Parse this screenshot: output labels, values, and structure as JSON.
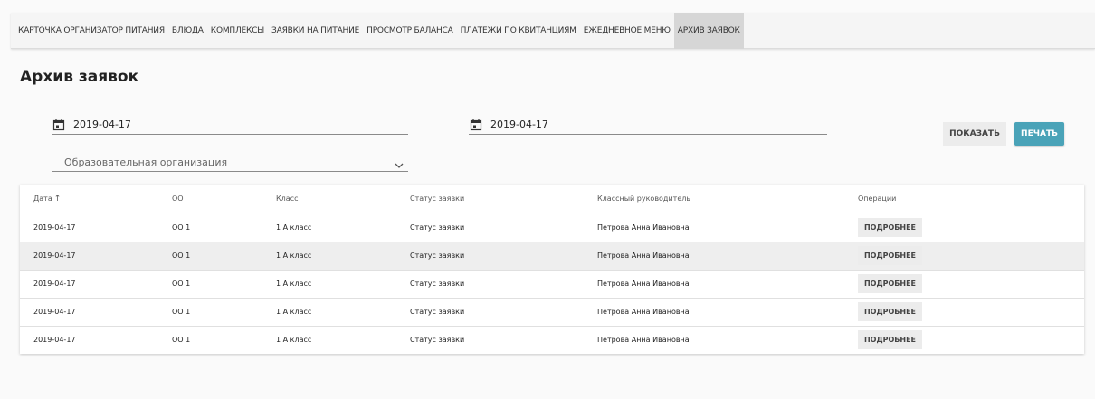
{
  "nav": {
    "items": [
      {
        "label": "КАРТОЧКА ОРГАНИЗАТОР ПИТАНИЯ"
      },
      {
        "label": "БЛЮДА"
      },
      {
        "label": "КОМПЛЕКСЫ"
      },
      {
        "label": "ЗАЯВКИ НА ПИТАНИЕ"
      },
      {
        "label": "ПРОСМОТР БАЛАНСА"
      },
      {
        "label": "ПЛАТЕЖИ ПО КВИТАНЦИЯМ"
      },
      {
        "label": "ЕЖЕДНЕВНОЕ МЕНЮ"
      },
      {
        "label": "АРХИВ ЗАЯВОК"
      }
    ],
    "active_index": 7
  },
  "page": {
    "title": "Архив заявок"
  },
  "filters": {
    "date_from": "2019-04-17",
    "date_to": "2019-04-17",
    "organization_placeholder": "Образовательная организация",
    "show_label": "ПОКАЗАТЬ",
    "print_label": "ПЕЧАТЬ"
  },
  "table": {
    "headers": {
      "date": "Дата",
      "org": "ОО",
      "class": "Класс",
      "status": "Статус заявки",
      "teacher": "Классный руководитель",
      "operations": "Операции"
    },
    "sort_icon": "arrow-up",
    "rows": [
      {
        "date": "2019-04-17",
        "org": "ОО 1",
        "class": "1 А класс",
        "status": "Статус заявки",
        "teacher": "Петрова Анна Ивановна",
        "action": "ПОДРОБНЕЕ"
      },
      {
        "date": "2019-04-17",
        "org": "ОО 1",
        "class": "1 А класс",
        "status": "Статус заявки",
        "teacher": "Петрова Анна Ивановна",
        "action": "ПОДРОБНЕЕ"
      },
      {
        "date": "2019-04-17",
        "org": "ОО 1",
        "class": "1 А класс",
        "status": "Статус заявки",
        "teacher": "Петрова Анна Ивановна",
        "action": "ПОДРОБНЕЕ"
      },
      {
        "date": "2019-04-17",
        "org": "ОО 1",
        "class": "1 А класс",
        "status": "Статус заявки",
        "teacher": "Петрова Анна Ивановна",
        "action": "ПОДРОБНЕЕ"
      },
      {
        "date": "2019-04-17",
        "org": "ОО 1",
        "class": "1 А класс",
        "status": "Статус заявки",
        "teacher": "Петрова Анна Ивановна",
        "action": "ПОДРОБНЕЕ"
      }
    ],
    "highlighted_row": 1
  },
  "colors": {
    "accent": "#4aa3b8",
    "active_tab": "#d6d6d6"
  }
}
